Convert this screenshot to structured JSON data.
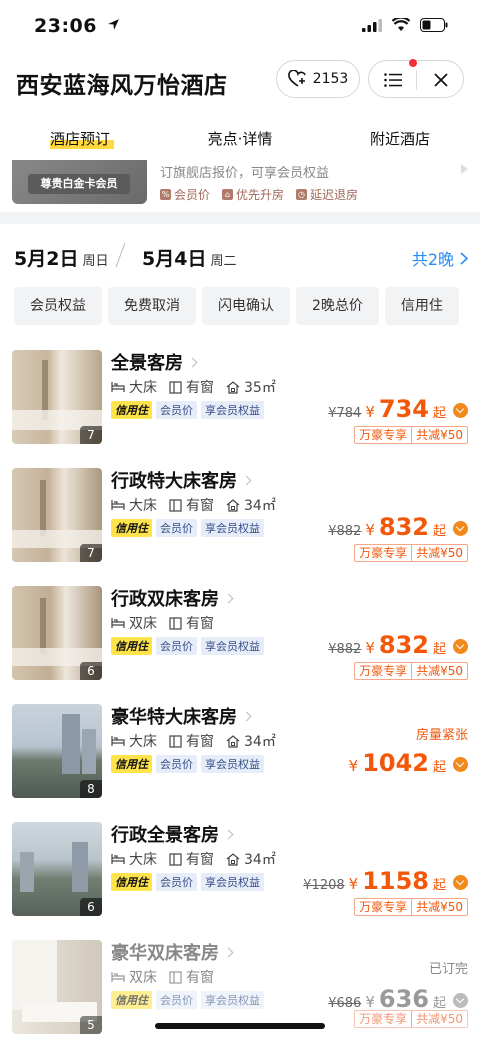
{
  "status": {
    "time": "23:06"
  },
  "header": {
    "title": "西安蓝海风万怡酒店",
    "favorites_count": "2153"
  },
  "tabs": [
    {
      "label": "酒店预订"
    },
    {
      "label": "亮点·详情"
    },
    {
      "label": "附近酒店"
    }
  ],
  "promo": {
    "badge": "尊贵白金卡会员",
    "text": "订旗舰店报价，可享会员权益",
    "tags": [
      "会员价",
      "优先升房",
      "延迟退房"
    ]
  },
  "dates": {
    "checkin": "5月2日",
    "checkin_day": "周日",
    "checkout": "5月4日",
    "checkout_day": "周二",
    "nights": "共2晚"
  },
  "filters": [
    "会员权益",
    "免费取消",
    "闪电确认",
    "2晚总价",
    "信用住"
  ],
  "tag_labels": {
    "credit": "信用住",
    "member_price": "会员价",
    "member_benefit": "享会员权益"
  },
  "rooms": [
    {
      "name": "全景客房",
      "bed": "大床",
      "window": "有窗",
      "area": "35㎡",
      "photos": "7",
      "orig_price": "¥784",
      "yen": "¥",
      "price": "734",
      "suffix": "起",
      "promo_a": "万豪专享",
      "promo_b": "共减¥50"
    },
    {
      "name": "行政特大床客房",
      "bed": "大床",
      "window": "有窗",
      "area": "34㎡",
      "photos": "7",
      "orig_price": "¥882",
      "yen": "¥",
      "price": "832",
      "suffix": "起",
      "promo_a": "万豪专享",
      "promo_b": "共减¥50"
    },
    {
      "name": "行政双床客房",
      "bed": "双床",
      "window": "有窗",
      "area": "",
      "photos": "6",
      "orig_price": "¥882",
      "yen": "¥",
      "price": "832",
      "suffix": "起",
      "promo_a": "万豪专享",
      "promo_b": "共减¥50"
    },
    {
      "name": "豪华特大床客房",
      "bed": "大床",
      "window": "有窗",
      "area": "34㎡",
      "photos": "8",
      "status": "房量紧张",
      "yen": "¥",
      "price": "1042",
      "suffix": "起"
    },
    {
      "name": "行政全景客房",
      "bed": "大床",
      "window": "有窗",
      "area": "34㎡",
      "photos": "6",
      "orig_price": "¥1208",
      "yen": "¥",
      "price": "1158",
      "suffix": "起",
      "promo_a": "万豪专享",
      "promo_b": "共减¥50"
    },
    {
      "name": "豪华双床客房",
      "bed": "双床",
      "window": "有窗",
      "area": "",
      "photos": "5",
      "status": "已订完",
      "orig_price": "¥686",
      "yen": "¥",
      "price": "636",
      "suffix": "起",
      "promo_a": "万豪专享",
      "promo_b": "共减¥50"
    }
  ],
  "colors": {
    "accent": "#f2570a",
    "link": "#2a8cf5",
    "highlight": "#ffd93f"
  }
}
